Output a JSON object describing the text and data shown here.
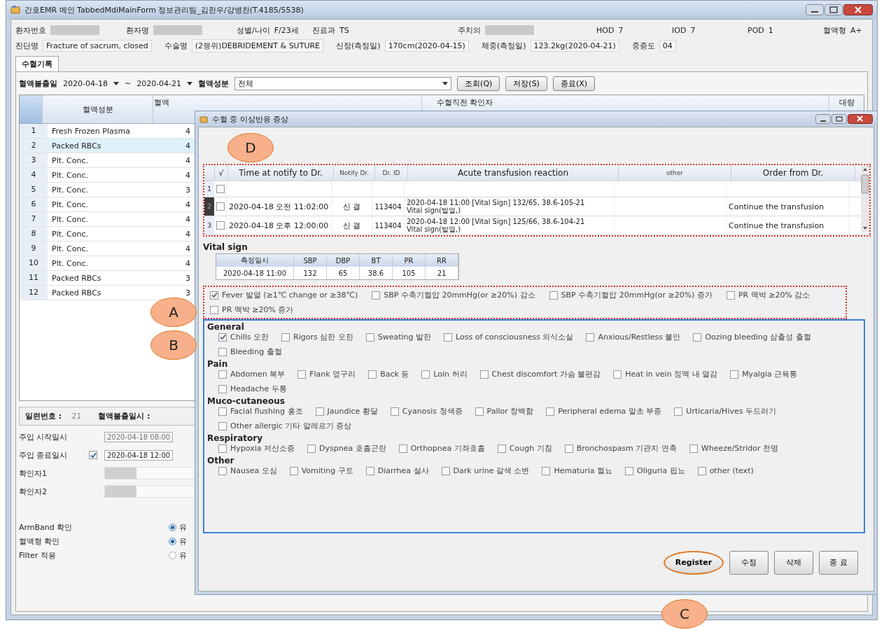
{
  "window": {
    "title": "간호EMR 메인 TabbedMdiMainForm 정보관리팀_김한우/강병찬(T.4185/5538)"
  },
  "patient_rows": [
    [
      {
        "label": "환자번호",
        "masked": true
      },
      {
        "label": "환자명",
        "masked": true
      },
      {
        "label": "성별/나이",
        "value": "F/23세"
      },
      {
        "label": "진료과",
        "value": "TS"
      },
      {
        "label": "주치의",
        "masked": true
      },
      {
        "label": "HOD",
        "value": "7"
      },
      {
        "label": "IOD",
        "value": "7"
      },
      {
        "label": "POD",
        "value": "1"
      },
      {
        "label": "혈액형",
        "value": "A+"
      }
    ],
    [
      {
        "label": "진단명",
        "value": "Fracture of sacrum, closed"
      },
      {
        "label": "수술명",
        "value": "(2행위)DEBRIDEMENT & SUTURE"
      },
      {
        "label": "신장(측정일)",
        "value": "170cm(2020-04-15)"
      },
      {
        "label": "체중(측정일)",
        "value": "123.2kg(2020-04-21)"
      },
      {
        "label": "중증도",
        "value": "04"
      }
    ]
  ],
  "tabs": [
    {
      "label": "수혈기록",
      "selected": true
    }
  ],
  "toolbar": {
    "date_label": "혈액불출일",
    "date_from": "2020-04-18",
    "separator": "~",
    "date_to": "2020-04-21",
    "component_label": "혈액성분",
    "component_value": "전체",
    "buttons": [
      "조회(Q)",
      "저장(S)",
      "종료(X)"
    ]
  },
  "blood_table": {
    "columns": [
      "혈액성분",
      "혈액",
      "수혈직전 확인자",
      "대량"
    ],
    "rows": [
      {
        "no": "1",
        "component": "Fresh Frozen Plasma",
        "column_2": "4",
        "selected": false
      },
      {
        "no": "2",
        "component": "Packed RBCs",
        "column_2": "4",
        "selected": true
      },
      {
        "no": "3",
        "component": "Plt. Conc.",
        "column_2": "4",
        "selected": false
      },
      {
        "no": "4",
        "component": "Plt. Conc.",
        "column_2": "4",
        "selected": false
      },
      {
        "no": "5",
        "component": "Plt. Conc.",
        "column_2": "3",
        "selected": false
      },
      {
        "no": "6",
        "component": "Plt. Conc.",
        "column_2": "4",
        "selected": false
      },
      {
        "no": "7",
        "component": "Plt. Conc.",
        "column_2": "4",
        "selected": false
      },
      {
        "no": "8",
        "component": "Plt. Conc.",
        "column_2": "4",
        "selected": false
      },
      {
        "no": "9",
        "component": "Plt. Conc.",
        "column_2": "4",
        "selected": false
      },
      {
        "no": "10",
        "component": "Plt. Conc.",
        "column_2": "4",
        "selected": false
      },
      {
        "no": "11",
        "component": "Packed RBCs",
        "column_2": "3",
        "selected": false
      },
      {
        "no": "12",
        "component": "Packed RBCs",
        "column_2": "3",
        "selected": false
      }
    ]
  },
  "detail": {
    "serial_label": "일련번호 :",
    "serial_value": "21",
    "issue_label": "혈액불출일시 :",
    "infusion": [
      {
        "label": "주입 시작일시",
        "value": "2020-04-18 08:00",
        "disabled": true,
        "kind": "plain"
      },
      {
        "label": "주입 종료일시",
        "value": "2020-04-18 12:00",
        "disabled": false,
        "kind": "checkbox",
        "checked": true
      }
    ],
    "checkers": [
      {
        "label": "확인자1",
        "masked": true
      },
      {
        "label": "확인자2",
        "masked": true
      }
    ],
    "checks": [
      {
        "label": "ArmBand 확인",
        "option": "유",
        "selected": true
      },
      {
        "label": "혈액형 확인",
        "option": "유",
        "selected": true
      },
      {
        "label": "Filter 적용",
        "option": "유",
        "selected": false
      }
    ]
  },
  "dialog": {
    "title": "수혈 중 이상반응 증상",
    "grid": {
      "columns": [
        "√",
        "Time at notify to Dr.",
        "Notify Dr.",
        "Dr. ID",
        "Acute transfusion reaction",
        "other",
        "Order from Dr."
      ],
      "rows": [
        {
          "no": "1",
          "selected": false,
          "checked": false
        },
        {
          "no": "2",
          "selected": true,
          "checked": false,
          "time": "2020-04-18 오전 11:02:00",
          "doctor": "신 결",
          "dr_id": "113404",
          "reaction": [
            "2020-04-18 11:00 [Vital Sign] 132/65, 38.6-105-21",
            "Vital sign(발열,)"
          ],
          "order": "Continue the transfusion"
        },
        {
          "no": "3",
          "selected": false,
          "checked": false,
          "time": "2020-04-18 오후 12:00:00",
          "doctor": "신 결",
          "dr_id": "113404",
          "reaction": [
            "2020-04-18 12:00 [Vital Sign] 125/66, 38.6-104-21",
            "Vital sign(발열,)"
          ],
          "order": "Continue the transfusion"
        }
      ]
    },
    "vital": {
      "title": "Vital sign",
      "columns": [
        "측정일시",
        "SBP",
        "DBP",
        "BT",
        "PR",
        "RR"
      ],
      "rows": [
        [
          "2020-04-18 11:00",
          "132",
          "65",
          "38.6",
          "105",
          "21"
        ]
      ]
    },
    "criteria": [
      {
        "label": "Fever 발열 (≥1℃ change or ≥38℃)",
        "checked": true
      },
      {
        "label": "SBP 수축기혈압 20mmHg(or ≥20%) 감소",
        "checked": false
      },
      {
        "label": "SBP 수축기혈압 20mmHg(or ≥20%) 증가",
        "checked": false
      },
      {
        "label": "PR 맥박 ≥20% 감소",
        "checked": false
      },
      {
        "label": "PR 맥박 ≥20% 증가",
        "checked": false
      }
    ],
    "symptoms": [
      {
        "group": "General",
        "items": [
          {
            "label": "Chills 오한",
            "checked": true
          },
          {
            "label": "Rigors 심한 오한",
            "checked": false
          },
          {
            "label": "Sweating 발한",
            "checked": false
          },
          {
            "label": "Loss of consciousness 의식소실",
            "checked": false
          },
          {
            "label": "Anxious/Restless 불안",
            "checked": false
          },
          {
            "label": "Oozing bleeding 삼출성 출혈",
            "checked": false
          },
          {
            "label": "Bleeding 출혈",
            "checked": false
          }
        ]
      },
      {
        "group": "Pain",
        "items": [
          {
            "label": "Abdomen 복부",
            "checked": false
          },
          {
            "label": "Flank 옆구리",
            "checked": false
          },
          {
            "label": "Back 등",
            "checked": false
          },
          {
            "label": "Loin 허리",
            "checked": false
          },
          {
            "label": "Chest discomfort 가슴 불편감",
            "checked": false
          },
          {
            "label": "Heat in vein 정맥 내 열감",
            "checked": false
          },
          {
            "label": "Myalgia 근육통",
            "checked": false
          },
          {
            "label": "Headache 두통",
            "checked": false
          }
        ]
      },
      {
        "group": "Muco-cutaneous",
        "items": [
          {
            "label": "Facial flushing 홍조",
            "checked": false
          },
          {
            "label": "Jaundice 황달",
            "checked": false
          },
          {
            "label": "Cyanosis 청색증",
            "checked": false
          },
          {
            "label": "Pallor 창백함",
            "checked": false
          },
          {
            "label": "Peripheral edema 말초 부종",
            "checked": false
          },
          {
            "label": "Urticaria/Hives 두드러기",
            "checked": false
          },
          {
            "label": "Other allergic 기타 알레르기 증상",
            "checked": false
          }
        ]
      },
      {
        "group": "Respiratory",
        "items": [
          {
            "label": "Hypoxia 저산소증",
            "checked": false
          },
          {
            "label": "Dyspnea 호흡곤란",
            "checked": false
          },
          {
            "label": "Orthopnea 기좌호흡",
            "checked": false
          },
          {
            "label": "Cough 기침",
            "checked": false
          },
          {
            "label": "Bronchospasm 기관지 연축",
            "checked": false
          },
          {
            "label": "Wheeze/Stridor 천명",
            "checked": false
          }
        ]
      },
      {
        "group": "Other",
        "items": [
          {
            "label": "Nausea 오심",
            "checked": false
          },
          {
            "label": "Vomiting 구토",
            "checked": false
          },
          {
            "label": "Diarrhea 설사",
            "checked": false
          },
          {
            "label": "Dark urine 갈색 소변",
            "checked": false
          },
          {
            "label": "Hematuria 혈뇨",
            "checked": false
          },
          {
            "label": "Oliguria 핍뇨",
            "checked": false
          },
          {
            "label": "other (text)",
            "checked": false
          }
        ]
      }
    ],
    "buttons": [
      {
        "label": "Register",
        "circled": true
      },
      {
        "label": "수정",
        "circled": false
      },
      {
        "label": "삭제",
        "circled": false
      },
      {
        "label": "종 료",
        "circled": false
      }
    ]
  },
  "annotations": [
    {
      "label": "D"
    },
    {
      "label": "A"
    },
    {
      "label": "B"
    },
    {
      "label": "C"
    }
  ]
}
